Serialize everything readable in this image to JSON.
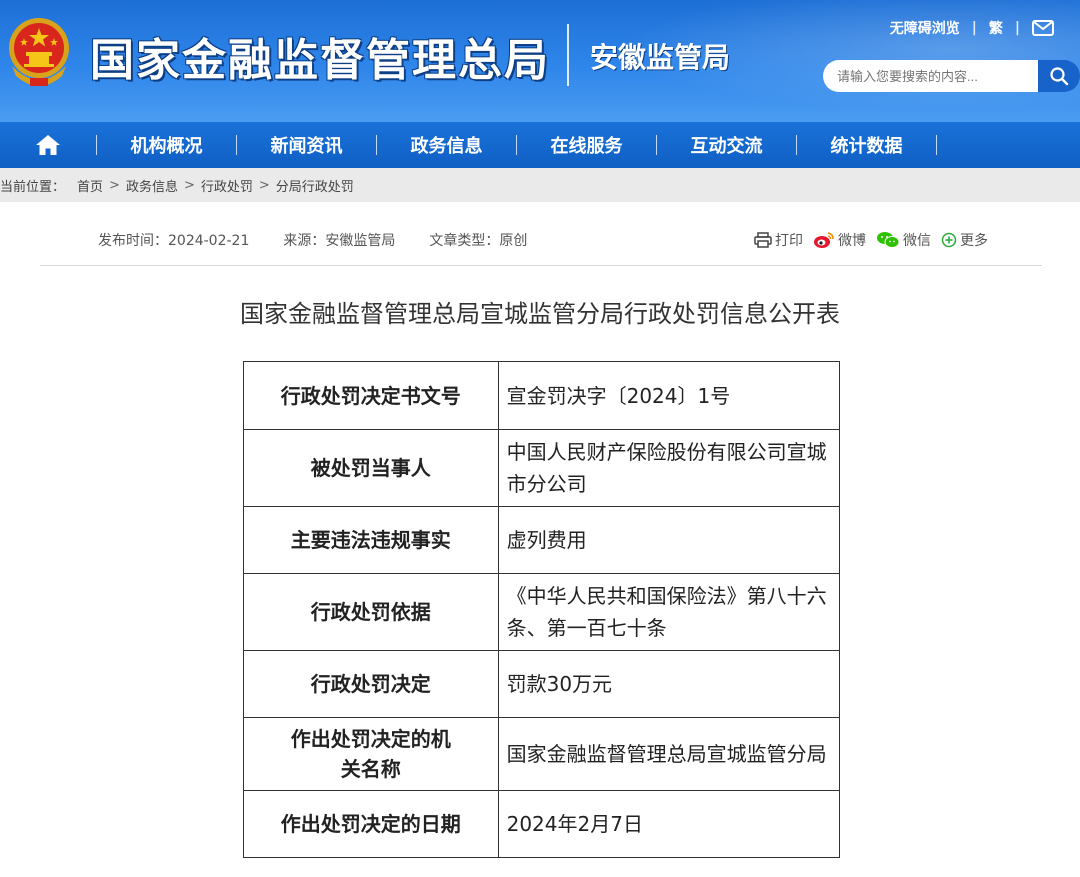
{
  "header": {
    "site_title": "国家金融监督管理总局",
    "sub_title": "安徽监管局",
    "links": {
      "accessibility": "无障碍浏览",
      "separator": "|",
      "traditional": "繁"
    },
    "search": {
      "placeholder": "请输入您要搜索的内容..."
    }
  },
  "nav": {
    "items": [
      "机构概况",
      "新闻资讯",
      "政务信息",
      "在线服务",
      "互动交流",
      "统计数据"
    ]
  },
  "breadcrumb": {
    "label": "当前位置：",
    "items": [
      "首页",
      "政务信息",
      "行政处罚",
      "分局行政处罚"
    ],
    "separator": ">"
  },
  "meta": {
    "publish_time": "发布时间：2024-02-21",
    "source": "来源：安徽监管局",
    "type": "文章类型：原创"
  },
  "share": {
    "print": "打印",
    "weibo": "微博",
    "wechat": "微信",
    "more": "更多"
  },
  "article": {
    "title": "国家金融监督管理总局宣城监管分局行政处罚信息公开表"
  },
  "table": {
    "rows": [
      {
        "label": "行政处罚决定书文号",
        "value": "宣金罚决字〔2024〕1号"
      },
      {
        "label": "被处罚当事人",
        "value": "中国人民财产保险股份有限公司宣城市分公司"
      },
      {
        "label": "主要违法违规事实",
        "value": "虚列费用"
      },
      {
        "label": "行政处罚依据",
        "value": "《中华人民共和国保险法》第八十六条、第一百七十条"
      },
      {
        "label": "行政处罚决定",
        "value": "罚款30万元"
      },
      {
        "label": "作出处罚决定的机关名称",
        "value": "国家金融监督管理总局宣城监管分局"
      },
      {
        "label": "作出处罚决定的日期",
        "value": "2024年2月7日"
      }
    ]
  },
  "colors": {
    "header_blue": "#2f86ea",
    "nav_blue": "#0f5fc4",
    "breadcrumb_bg": "#eaeaea"
  },
  "icons": [
    "emblem-icon",
    "mail-icon",
    "search-icon",
    "home-icon",
    "print-icon",
    "weibo-icon",
    "wechat-icon",
    "more-icon"
  ]
}
